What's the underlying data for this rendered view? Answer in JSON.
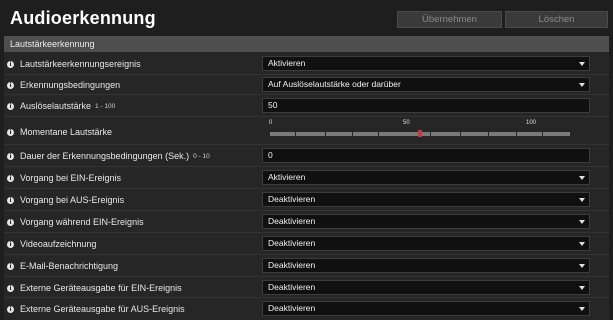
{
  "header": {
    "title": "Audioerkennung",
    "apply_label": "Übernehmen",
    "delete_label": "Löschen"
  },
  "section": {
    "title": "Lautstärkeerkennung"
  },
  "rows": [
    {
      "label": "Lautstärkeerkennungsereignis",
      "type": "select",
      "value": "Aktivieren"
    },
    {
      "label": "Erkennungsbedingungen",
      "type": "select",
      "value": "Auf Auslöselautstärke oder darüber"
    },
    {
      "label": "Auslöselautstärke",
      "range": "1 - 100",
      "type": "input",
      "value": "50"
    },
    {
      "label": "Momentane Lautstärke",
      "type": "meter",
      "ticks": [
        "0",
        "50",
        "100"
      ],
      "level": 50
    },
    {
      "label": "Dauer der Erkennungsbedingungen (Sek.)",
      "range": "0 - 10",
      "type": "input",
      "value": "0"
    },
    {
      "label": "Vorgang bei EIN-Ereignis",
      "type": "select",
      "value": "Aktivieren"
    },
    {
      "label": "Vorgang bei AUS-Ereignis",
      "type": "select",
      "value": "Deaktivieren"
    },
    {
      "label": "Vorgang während EIN-Ereignis",
      "type": "select",
      "value": "Deaktivieren"
    },
    {
      "label": "Videoaufzeichnung",
      "type": "select",
      "value": "Deaktivieren"
    },
    {
      "label": "E-Mail-Benachrichtigung",
      "type": "select",
      "value": "Deaktivieren"
    },
    {
      "label": "Externe Geräteausgabe für EIN-Ereignis",
      "type": "select",
      "value": "Deaktivieren"
    },
    {
      "label": "Externe Geräteausgabe für AUS-Ereignis",
      "type": "select",
      "value": "Deaktivieren"
    }
  ],
  "icons": {
    "info": "info-icon",
    "dropdown": "chevron-down-icon"
  },
  "colors": {
    "background": "#1e1e1e",
    "panel": "#262626",
    "section_header": "#4e4e4e",
    "field": "#101010",
    "meter_marker": "#c23a3a"
  }
}
